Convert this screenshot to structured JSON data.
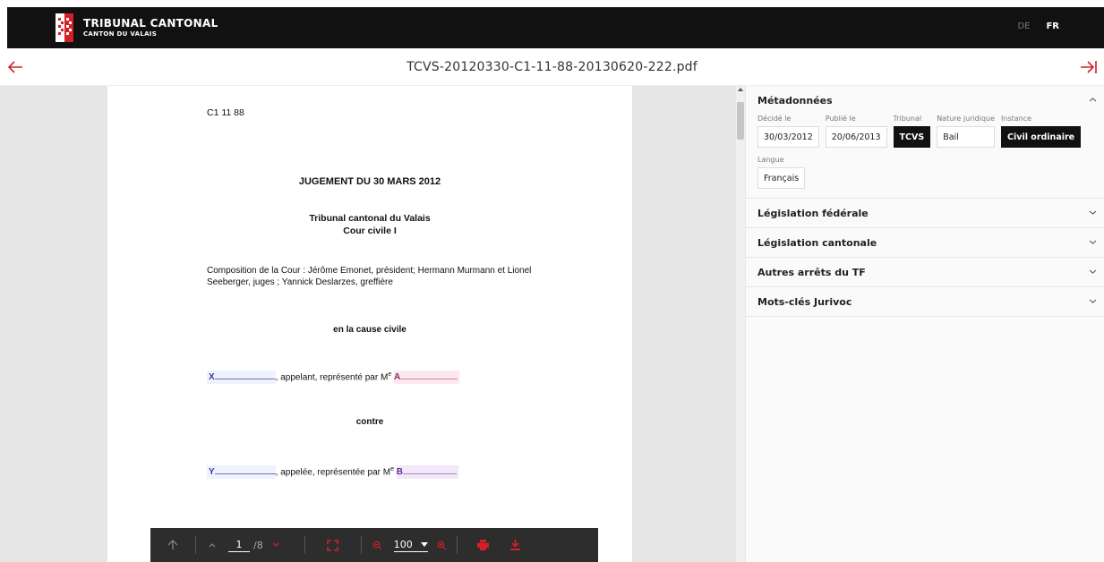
{
  "header": {
    "brand_title": "TRIBUNAL CANTONAL",
    "brand_subtitle": "CANTON DU VALAIS",
    "languages": [
      "DE",
      "FR"
    ],
    "active_language": "FR"
  },
  "titlebar": {
    "filename": "TCVS-20120330-C1-11-88-20130620-222.pdf"
  },
  "document": {
    "ref": "C1 11 88",
    "heading": "JUGEMENT DU 30 MARS 2012",
    "court_line1": "Tribunal cantonal du Valais",
    "court_line2": "Cour civile I",
    "composition_line1": "Composition de la Cour : Jérôme Emonet, président; Hermann Murmann et Lionel",
    "composition_line2": "Seeberger, juges ; Yannick Deslarzes, greffière",
    "cause": "en la cause civile",
    "party1_letter": "X",
    "party1_text": ", appelant, représenté par M",
    "party1_lawyer": "A",
    "contre": "contre",
    "party2_letter": "Y",
    "party2_text": ", appelée, représentée par M",
    "party2_lawyer": "B",
    "superscript": "e"
  },
  "toolbar": {
    "page": "1",
    "page_total": "/8",
    "zoom": "100"
  },
  "panel": {
    "metadata_title": "Métadonnées",
    "fields": [
      {
        "label": "Décidé le",
        "value": "30/03/2012",
        "dark": false
      },
      {
        "label": "Publié le",
        "value": "20/06/2013",
        "dark": false
      },
      {
        "label": "Tribunal",
        "value": "TCVS",
        "dark": true
      },
      {
        "label": "Nature juridique",
        "value": "Bail",
        "dark": false
      },
      {
        "label": "Instance",
        "value": "Civil ordinaire",
        "dark": true
      }
    ],
    "language_label": "Langue",
    "language_value": "Français",
    "sections": [
      "Législation fédérale",
      "Législation cantonale",
      "Autres arrêts du TF",
      "Mots-clés Jurivoc"
    ]
  },
  "colors": {
    "accent": "#d42027",
    "topbar": "#111111",
    "toolbar": "#2d2d2d"
  }
}
